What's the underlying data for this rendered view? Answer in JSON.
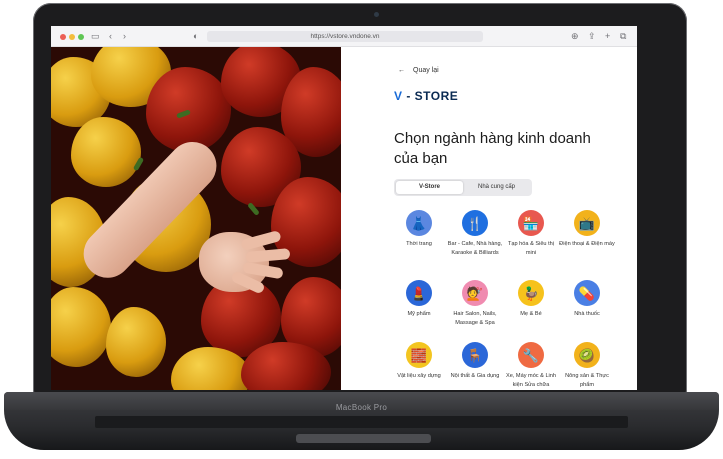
{
  "browser": {
    "url": "https://vstore.vndone.vn"
  },
  "device": {
    "label": "MacBook Pro"
  },
  "page": {
    "back_label": "Quay lại",
    "logo_v": "V",
    "logo_rest": " - STORE",
    "heading": "Chọn ngành hàng kinh doanh của bạn",
    "tabs": [
      {
        "label": "V-Store",
        "active": true
      },
      {
        "label": "Nhà cung cấp",
        "active": false
      }
    ],
    "categories": [
      {
        "label": "Thời trang",
        "icon": "dress-icon",
        "glyph": "👗",
        "color": "#5b87e0"
      },
      {
        "label": "Bar - Cafe, Nhà hàng, Karaoke & Billiards",
        "icon": "cutlery-icon",
        "glyph": "🍴",
        "color": "#1f6fe0"
      },
      {
        "label": "Tạp hóa & Siêu thị mini",
        "icon": "store-icon",
        "glyph": "🏪",
        "color": "#e8584f"
      },
      {
        "label": "Điện thoại & Điện máy",
        "icon": "tv-icon",
        "glyph": "📺",
        "color": "#f2b21b"
      },
      {
        "label": "Mỹ phẩm",
        "icon": "cosmetics-icon",
        "glyph": "💄",
        "color": "#2b67d8"
      },
      {
        "label": "Hair Salon, Nails, Massage & Spa",
        "icon": "comb-icon",
        "glyph": "💇",
        "color": "#f08bb0"
      },
      {
        "label": "Mẹ & Bé",
        "icon": "duck-icon",
        "glyph": "🦆",
        "color": "#f6c21c"
      },
      {
        "label": "Nhà thuốc",
        "icon": "pharmacy-icon",
        "glyph": "💊",
        "color": "#4a7fe4"
      },
      {
        "label": "Vật liệu xây dựng",
        "icon": "paint-roller-icon",
        "glyph": "🧱",
        "color": "#f3c520"
      },
      {
        "label": "Nội thất & Gia dụng",
        "icon": "table-icon",
        "glyph": "🪑",
        "color": "#2b67d8"
      },
      {
        "label": "Xe, Máy móc & Linh kiện Sửa chữa",
        "icon": "drill-icon",
        "glyph": "🔧",
        "color": "#ef6a42"
      },
      {
        "label": "Nông sản & Thực phẩm",
        "icon": "fruit-icon",
        "glyph": "🥝",
        "color": "#f2b21b"
      }
    ]
  }
}
